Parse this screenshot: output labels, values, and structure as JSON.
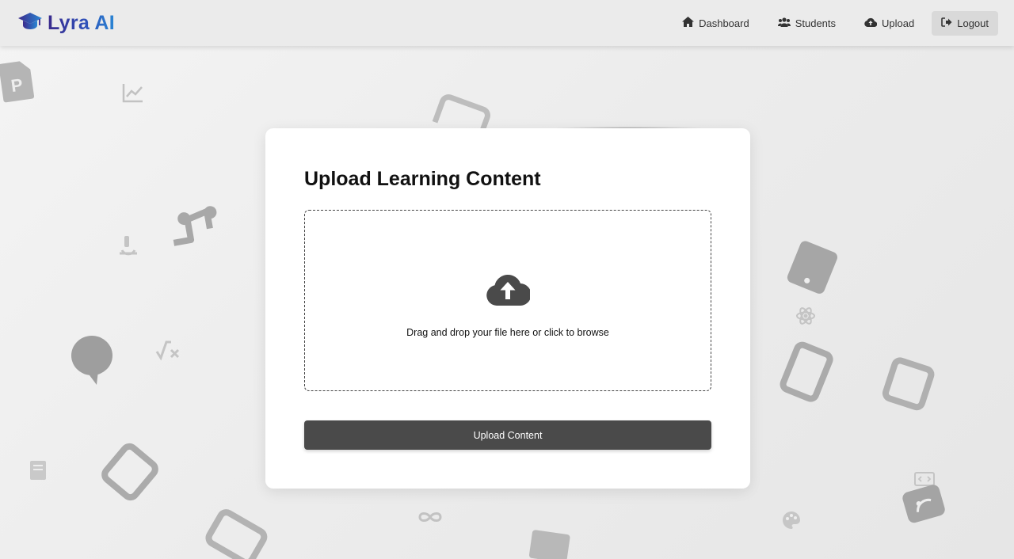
{
  "brand": {
    "name": "Lyra AI",
    "icon": "graduation-cap-icon",
    "gradient": [
      "#3a2a8c",
      "#2a86d4"
    ]
  },
  "nav": {
    "items": [
      {
        "label": "Dashboard",
        "icon": "home-icon"
      },
      {
        "label": "Students",
        "icon": "users-icon"
      },
      {
        "label": "Upload",
        "icon": "cloud-upload-icon"
      }
    ],
    "logout": {
      "label": "Logout",
      "icon": "sign-out-icon"
    }
  },
  "upload": {
    "title": "Upload Learning Content",
    "dropzone_text": "Drag and drop your file here or click to browse",
    "dropzone_icon": "cloud-upload-icon",
    "button_label": "Upload Content"
  },
  "colors": {
    "button": "#4a4a4a",
    "card": "#ffffff",
    "background": "#ececec"
  }
}
